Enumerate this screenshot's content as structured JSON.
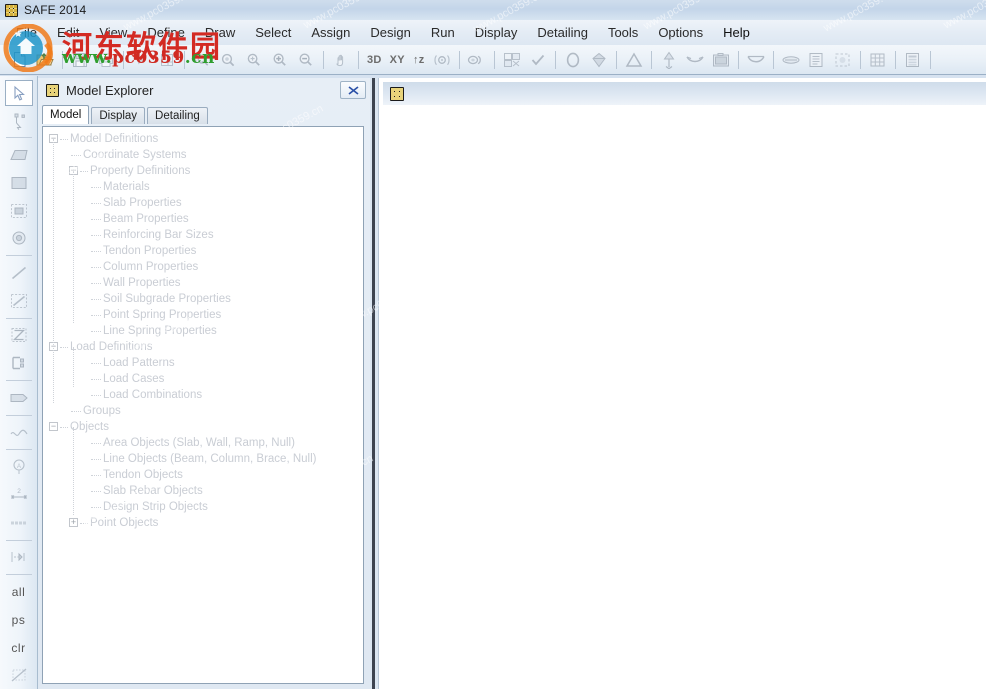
{
  "window": {
    "title": "SAFE 2014",
    "app_icon": "safe-grid-icon"
  },
  "menubar": {
    "items": [
      {
        "label": "File"
      },
      {
        "label": "Edit"
      },
      {
        "label": "View"
      },
      {
        "label": "Define"
      },
      {
        "label": "Draw"
      },
      {
        "label": "Select"
      },
      {
        "label": "Assign"
      },
      {
        "label": "Design"
      },
      {
        "label": "Run"
      },
      {
        "label": "Display"
      },
      {
        "label": "Detailing"
      },
      {
        "label": "Tools"
      },
      {
        "label": "Options"
      },
      {
        "label": "Help"
      }
    ]
  },
  "toolbar": {
    "labels": {
      "view_3d": "3D",
      "view_xy": "XY",
      "view_z": "↑z"
    },
    "icons": [
      "new-model-icon",
      "open-file-icon",
      "save-icon",
      "print-icon",
      "run-analysis-icon",
      "lock-model-icon",
      "zoom-rubber-band-icon",
      "zoom-full-icon",
      "zoom-previous-icon",
      "zoom-in-icon",
      "zoom-out-icon",
      "pan-hand-icon",
      "view-3d-icon",
      "view-xy-icon",
      "view-z-icon",
      "view-rotate-icon",
      "object-shrink-icon",
      "set-display-options-icon",
      "check-model-icon",
      "show-undeformed-icon",
      "show-loads-icon",
      "show-deformed-icon",
      "show-slab-forces-icon",
      "show-reactions-icon",
      "snapshot-icon",
      "show-reinforcement-icon",
      "show-detailing-icon",
      "detailing-sheet-icon",
      "select-window-icon",
      "grid-icon",
      "tables-icon"
    ]
  },
  "left_toolbar": {
    "items": [
      {
        "name": "pointer-select-tool",
        "type": "icon",
        "selected": true
      },
      {
        "name": "reshape-object-tool",
        "type": "icon",
        "selected": false
      },
      {
        "name": "draw-quad-area-tool",
        "type": "icon",
        "selected": false
      },
      {
        "name": "draw-rect-area-tool",
        "type": "icon",
        "selected": false
      },
      {
        "name": "draw-rect-in-region-tool",
        "type": "icon",
        "selected": false
      },
      {
        "name": "draw-circular-area-tool",
        "type": "icon",
        "selected": false
      },
      {
        "name": "draw-line-object-tool",
        "type": "icon",
        "selected": false
      },
      {
        "name": "draw-line-in-region-tool",
        "type": "icon",
        "selected": false
      },
      {
        "name": "draw-design-strip-tool",
        "type": "icon",
        "selected": false
      },
      {
        "name": "draw-slab-rebar-tool",
        "type": "icon",
        "selected": false
      },
      {
        "name": "draw-tendon-tool",
        "type": "icon",
        "selected": false
      },
      {
        "name": "draw-spline-tool",
        "type": "icon",
        "selected": false
      },
      {
        "name": "draw-point-object-tool",
        "type": "icon",
        "selected": false
      },
      {
        "name": "dimension-line-tool",
        "type": "icon",
        "selected": false
      },
      {
        "name": "draw-strip-layer-tool",
        "type": "icon",
        "selected": false
      },
      {
        "name": "snap-tool",
        "type": "icon",
        "selected": false
      },
      {
        "name": "select-all-button",
        "type": "text",
        "label": "all"
      },
      {
        "name": "select-previous-button",
        "type": "text",
        "label": "ps"
      },
      {
        "name": "clear-selection-button",
        "type": "text",
        "label": "clr"
      },
      {
        "name": "snap-off-icon",
        "type": "icon",
        "selected": false
      }
    ]
  },
  "model_explorer": {
    "title": "Model Explorer",
    "close_label": "✕",
    "tabs": [
      {
        "label": "Model",
        "active": true
      },
      {
        "label": "Display",
        "active": false
      },
      {
        "label": "Detailing",
        "active": false
      }
    ],
    "tree": [
      {
        "label": "Model Definitions",
        "level": 0,
        "expander": "minus"
      },
      {
        "label": "Coordinate Systems",
        "level": 1,
        "expander": "none"
      },
      {
        "label": "Property Definitions",
        "level": 1,
        "expander": "minus"
      },
      {
        "label": "Materials",
        "level": 2,
        "expander": "none"
      },
      {
        "label": "Slab Properties",
        "level": 2,
        "expander": "none"
      },
      {
        "label": "Beam Properties",
        "level": 2,
        "expander": "none"
      },
      {
        "label": "Reinforcing Bar Sizes",
        "level": 2,
        "expander": "none"
      },
      {
        "label": "Tendon Properties",
        "level": 2,
        "expander": "none"
      },
      {
        "label": "Column Properties",
        "level": 2,
        "expander": "none"
      },
      {
        "label": "Wall Properties",
        "level": 2,
        "expander": "none"
      },
      {
        "label": "Soil Subgrade Properties",
        "level": 2,
        "expander": "none"
      },
      {
        "label": "Point Spring Properties",
        "level": 2,
        "expander": "none"
      },
      {
        "label": "Line Spring Properties",
        "level": 2,
        "expander": "none"
      },
      {
        "label": "Load Definitions",
        "level": 0,
        "expander": "minus"
      },
      {
        "label": "Load Patterns",
        "level": 2,
        "expander": "none"
      },
      {
        "label": "Load Cases",
        "level": 2,
        "expander": "none"
      },
      {
        "label": "Load Combinations",
        "level": 2,
        "expander": "none"
      },
      {
        "label": "Groups",
        "level": 1,
        "expander": "none"
      },
      {
        "label": "Objects",
        "level": 0,
        "expander": "minus"
      },
      {
        "label": "Area Objects (Slab, Wall, Ramp, Null)",
        "level": 2,
        "expander": "none"
      },
      {
        "label": "Line Objects (Beam, Column, Brace, Null)",
        "level": 2,
        "expander": "none"
      },
      {
        "label": "Tendon Objects",
        "level": 2,
        "expander": "none"
      },
      {
        "label": "Slab Rebar Objects",
        "level": 2,
        "expander": "none"
      },
      {
        "label": "Design Strip Objects",
        "level": 2,
        "expander": "none"
      },
      {
        "label": "Point Objects",
        "level": 1,
        "expander": "plus"
      }
    ]
  },
  "mdi": {
    "child_icon": "safe-model-window-icon"
  },
  "watermark": {
    "site_name": "河东软件园",
    "url_green": "www.",
    "url_red": "pc0359",
    "url_green2": ".cn",
    "tile_text": "www.pc0359.cn"
  },
  "colors": {
    "title_bar": "#c3d5e9",
    "menu_bar": "#e4ecf5",
    "panel_bg": "#e3ecf5",
    "canvas": "#ffffff",
    "tree_text_disabled": "#c9cdd4",
    "watermark_red": "#d32a23",
    "watermark_green": "#2f9e2f",
    "splitter": "#3d4450"
  }
}
